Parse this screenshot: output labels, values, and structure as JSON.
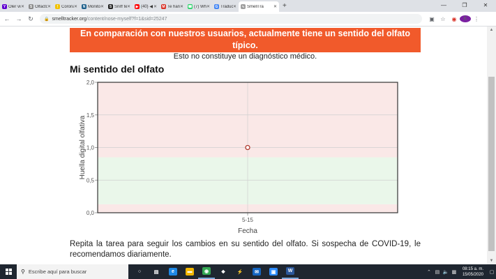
{
  "browser": {
    "tabs": [
      {
        "title": "Oler vinag",
        "icon": "yahoo-icon",
        "color": "#5f01d1",
        "glyph": "Y"
      },
      {
        "title": "Olfactory",
        "icon": "olfactory-icon",
        "color": "#888888",
        "glyph": "S"
      },
      {
        "title": "Coronavi",
        "icon": "coronavirus-icon",
        "color": "#f2c200",
        "glyph": "!"
      },
      {
        "title": "Monitori",
        "icon": "n-icon",
        "color": "#1b5e8a",
        "glyph": "N"
      },
      {
        "title": "Sniff test",
        "icon": "sniff-icon",
        "color": "#222222",
        "glyph": "S"
      },
      {
        "title": "(40) ◀",
        "icon": "youtube-icon",
        "color": "#ff0000",
        "glyph": "▶"
      },
      {
        "title": "Te han in",
        "icon": "gmail-icon",
        "color": "#d93025",
        "glyph": "M"
      },
      {
        "title": "(7) What",
        "icon": "whatsapp-icon",
        "color": "#25d366",
        "glyph": "☎"
      },
      {
        "title": "Traducto",
        "icon": "translate-icon",
        "color": "#4285f4",
        "glyph": "G"
      },
      {
        "title": "SmellTra",
        "icon": "smelltracker-icon",
        "color": "#9e9e9e",
        "glyph": "∿",
        "active": true
      }
    ],
    "new_tab": "+",
    "window_controls": {
      "minimize": "—",
      "maximize": "❐",
      "close": "✕"
    },
    "nav": {
      "back": "←",
      "forward": "→",
      "reload": "↻"
    },
    "url_host": "smelltracker.org",
    "url_path": "/content/nose-myself?f=1&sid=25247",
    "toolbar_icons": [
      "translate-icon",
      "star-icon",
      "extension-icon"
    ],
    "profile_initial": "K"
  },
  "page": {
    "banner": "En comparación con nuestros usuarios, actualmente tiene un sentido del olfato típico.",
    "disclaimer": "Esto no constituye un diagnóstico médico.",
    "section_title": "Mi sentido del olfato",
    "body": "Repita la tarea para seguir los cambios en su sentido del olfato. Si sospecha de COVID-19, le recomendamos diariamente."
  },
  "chart_data": {
    "type": "scatter",
    "title": "",
    "xlabel": "Fecha",
    "ylabel": "Huella digital olfativa",
    "categories": [
      "5-15"
    ],
    "ylim": [
      0,
      2
    ],
    "yticks": [
      "0,0",
      "0,5",
      "1,0",
      "1,5",
      "2,0"
    ],
    "bands": [
      {
        "from": 0.0,
        "to": 0.13,
        "color": "#fae8e7"
      },
      {
        "from": 0.13,
        "to": 0.85,
        "color": "#eaf7ea"
      },
      {
        "from": 0.85,
        "to": 2.0,
        "color": "#fae8e7"
      }
    ],
    "series": [
      {
        "values": [
          1.0
        ],
        "color": "#b03a2e"
      }
    ],
    "grid": true
  },
  "taskbar": {
    "search_placeholder": "Escribe aquí para buscar",
    "apps": [
      {
        "name": "cortana-icon",
        "glyph": "○",
        "color": "transparent"
      },
      {
        "name": "task-view-icon",
        "glyph": "▤",
        "color": "transparent"
      },
      {
        "name": "edge-icon",
        "glyph": "e",
        "color": "#1e88e5"
      },
      {
        "name": "file-explorer-icon",
        "glyph": "▬",
        "color": "#f2b600"
      },
      {
        "name": "chrome-icon",
        "glyph": "◉",
        "color": "#34a853",
        "open": true
      },
      {
        "name": "dropbox-icon",
        "glyph": "❖",
        "color": "transparent"
      },
      {
        "name": "winamp-icon",
        "glyph": "⚡",
        "color": "transparent"
      },
      {
        "name": "mail-icon",
        "glyph": "✉",
        "color": "#1565c0"
      },
      {
        "name": "zoom-icon",
        "glyph": "▣",
        "color": "#2d8cff"
      },
      {
        "name": "word-icon",
        "glyph": "W",
        "color": "#2b579a",
        "open": true
      }
    ],
    "tray_icons": [
      "chevron-up-icon",
      "network-icon",
      "volume-icon",
      "language-icon"
    ],
    "time": "08:15 a. m.",
    "date": "15/05/2020"
  }
}
